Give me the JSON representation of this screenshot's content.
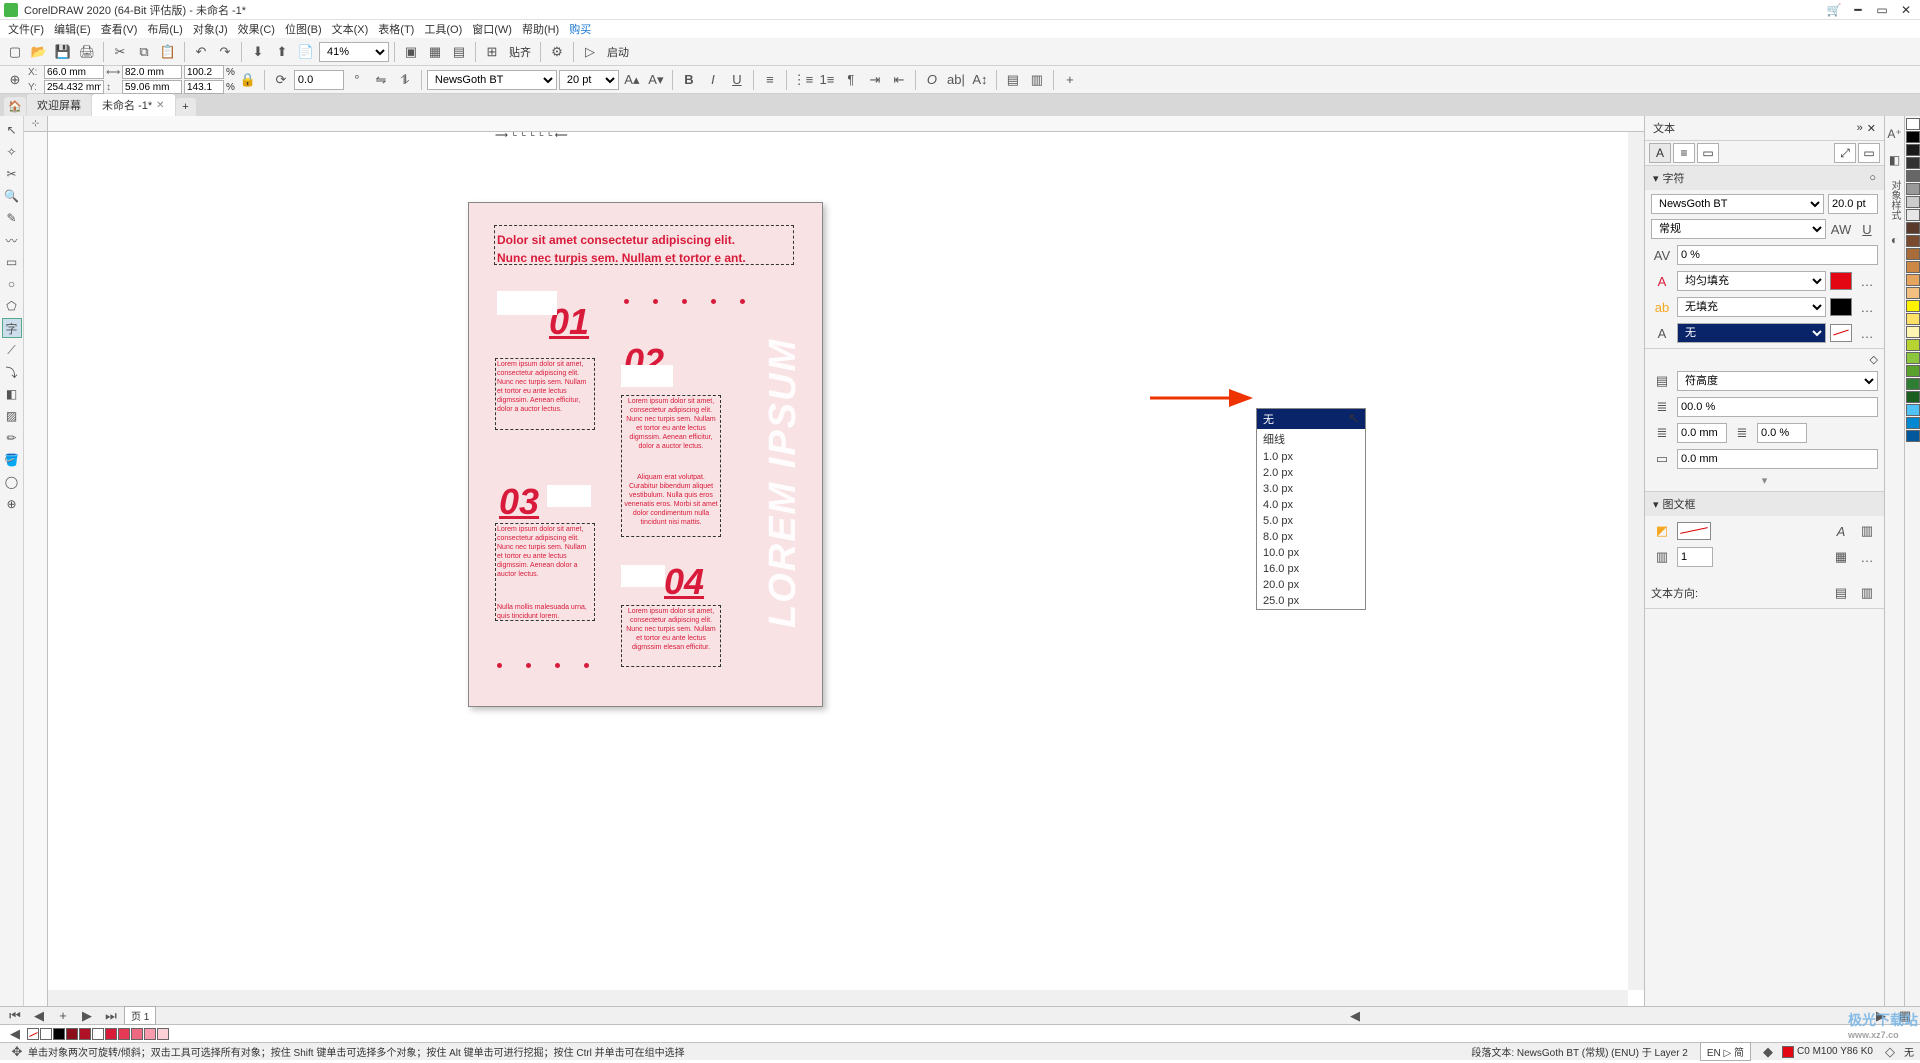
{
  "window": {
    "title": "CorelDRAW 2020 (64-Bit 评估版) - 未命名 -1*"
  },
  "menu": [
    "文件(F)",
    "编辑(E)",
    "查看(V)",
    "布局(L)",
    "对象(J)",
    "效果(C)",
    "位图(B)",
    "文本(X)",
    "表格(T)",
    "工具(O)",
    "窗口(W)",
    "帮助(H)",
    "购买"
  ],
  "toolbar1": {
    "zoom": "41%",
    "snap": "贴齐",
    "launch": "启动"
  },
  "toolbar2": {
    "x": "66.0 mm",
    "y": "254.432 mm",
    "w": "82.0 mm",
    "h": "59.06 mm",
    "sx": "100.2",
    "sy": "143.1",
    "pct": "%",
    "rot": "0.0",
    "font": "NewsGoth BT",
    "size": "20 pt"
  },
  "tabs": {
    "welcome": "欢迎屏幕",
    "doc": "未命名 -1*"
  },
  "rightPanel": {
    "title": "文本",
    "section_char": "字符",
    "font": "NewsGoth BT",
    "size": "20.0 pt",
    "style": "常规",
    "kern": "0 %",
    "fill_mode": "均匀填充",
    "outline_fill": "无填充",
    "outline_width_value": "无",
    "dropdown": [
      "无",
      "细线",
      "1.0 px",
      "2.0 px",
      "3.0 px",
      "4.0 px",
      "5.0 px",
      "8.0 px",
      "10.0 px",
      "16.0 px",
      "20.0 px",
      "25.0 px"
    ],
    "charHeightLabel": "符高度",
    "pct100": "00.0 %",
    "pct0": "0.0 %",
    "mm0": "0.0 mm",
    "section_frame": "图文框",
    "columns": "1",
    "dir_label": "文本方向:"
  },
  "page": {
    "title_line1": "Dolor sit amet consectetur adipiscing elit.",
    "title_line2": "Nunc nec turpis sem. Nullam et tortor e ant.",
    "n01": "01",
    "n02": "02",
    "n03": "03",
    "n04": "04",
    "body1": "Lorem ipsum dolor sit amet, consectetur adipiscing elit. Nunc nec turpis sem. Nullam et tortor eu ante lectus digmssim. Aenean efficitur, dolor a auctor lectus.",
    "body2": "Lorem ipsum dolor sit amet, consectetur adipiscing elit. Nunc nec turpis sem. Nullam et tortor eu ante lectus digmssim. Aenean efficitur, dolor a auctor lectus.",
    "body2b": "Aliquam erat volutpat. Curabitur bibendum aliquet vestibulum. Nulla quis eros venenatis eros. Morbi sit amet dolor condimentum nulla tincidunt nisi mattis.",
    "body3": "Lorem ipsum dolor sit amet, consectetur adipiscing elit. Nunc nec turpis sem. Nullam et tortor eu ante lectus digmssim. Aenean dolor a auctor lectus.",
    "body3b": "Nulla mollis malesuada urna, quis tincidunt lorem.",
    "body4": "Lorem ipsum dolor sit amet, consectetur adipiscing elit. Nunc nec turpis sem. Nullam et tortor eu ante lectus digmssim elesan efficitur.",
    "vertical": "LOREM IPSUM"
  },
  "pagenav": {
    "page1": "页 1"
  },
  "status": {
    "left": "单击对象两次可旋转/倾斜；双击工具可选择所有对象；按住 Shift 键单击可选择多个对象；按住 Alt 键单击可进行挖掘；按住 Ctrl 并单击可在组中选择",
    "mid": "段落文本:   NewsGoth BT (常规) (ENU) 于 Layer 2",
    "lang": "EN ▷ 简",
    "swatch": "C0 M100 Y86 K0",
    "none": "无"
  },
  "palette_colors": [
    "#ffffff",
    "#000000",
    "#1a1a1a",
    "#333333",
    "#666666",
    "#999999",
    "#cccccc",
    "#e6e6e6",
    "#593a2b",
    "#7a4a2f",
    "#a86b3a",
    "#cc8844",
    "#e6a55e",
    "#f2c080",
    "#fff200",
    "#ffe066",
    "#fff5b3",
    "#b7d332",
    "#8cc63f",
    "#5aa02c",
    "#2e7d32",
    "#1b5e20",
    "#4fc3f7",
    "#0288d1",
    "#01579b"
  ],
  "colorbar": [
    "#ffffff",
    "#000000",
    "#8a0f1a",
    "#b01127",
    "#ffffff",
    "#d81b3a",
    "#e43a56",
    "#ee6a80",
    "#f79aab",
    "#fdd0d8"
  ]
}
